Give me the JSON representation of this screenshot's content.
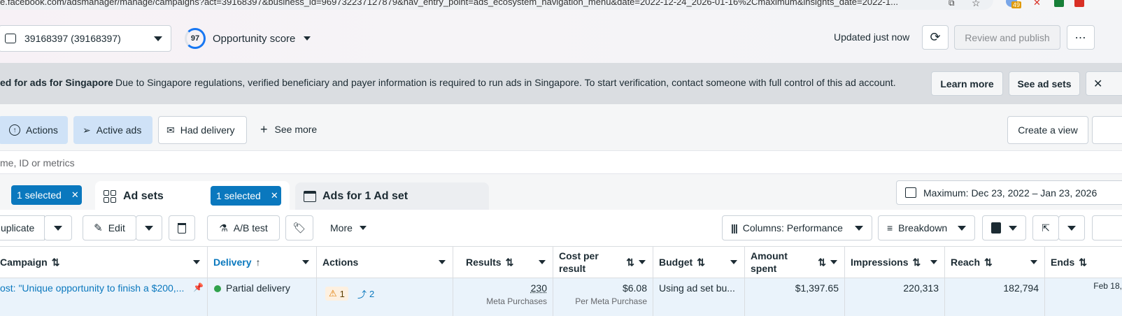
{
  "browser": {
    "url": "e.facebook.com/adsmanager/manage/campaigns?act=39168397&business_id=969732237127879&nav_entry_point=ads_ecosystem_navigation_menu&date=2022-12-24_2026-01-16%2Cmaximum&insights_date=2022-1...",
    "ext_badge": "49"
  },
  "topbar": {
    "account": "39168397 (39168397)",
    "score": "97",
    "opportunity": "Opportunity score",
    "updated": "Updated just now",
    "review": "Review and publish"
  },
  "banner": {
    "title": "ed for ads for Singapore",
    "text": "Due to Singapore regulations, verified beneficiary and payer information is required to run ads in Singapore. To start verification, contact someone with full control of this ad account.",
    "learn": "Learn more",
    "see_ad_sets": "See ad sets"
  },
  "filters": {
    "actions": "Actions",
    "active_ads": "Active ads",
    "had_delivery": "Had delivery",
    "see_more": "See more",
    "create_view": "Create a view"
  },
  "search": {
    "placeholder": "me, ID or metrics"
  },
  "tabs": {
    "campaign_selected": "1 selected",
    "ad_sets": "Ad sets",
    "adsets_selected": "1 selected",
    "ads": "Ads for 1 Ad set",
    "date": "Maximum: Dec 23, 2022 – Jan 23, 2026"
  },
  "toolbar": {
    "duplicate": "uplicate",
    "edit": "Edit",
    "ab_test": "A/B test",
    "more": "More",
    "columns": "Columns: Performance",
    "breakdown": "Breakdown"
  },
  "table": {
    "headers": {
      "campaign": "Campaign",
      "delivery": "Delivery",
      "actions": "Actions",
      "results": "Results",
      "cost_per_result_1": "Cost per",
      "cost_per_result_2": "result",
      "budget": "Budget",
      "amount_spent_1": "Amount",
      "amount_spent_2": "spent",
      "impressions": "Impressions",
      "reach": "Reach",
      "ends": "Ends"
    },
    "row": {
      "campaign": "ost: \"Unique opportunity to finish a $200,...",
      "delivery": "Partial delivery",
      "warning_count": "1",
      "recs_count": "2",
      "results": "230",
      "results_sub": "Meta Purchases",
      "cost": "$6.08",
      "cost_sub": "Per Meta Purchase",
      "budget": "Using ad set bu...",
      "amount_spent": "$1,397.65",
      "impressions": "220,313",
      "reach": "182,794",
      "ends": "Feb 18,"
    }
  },
  "colors": {
    "accent": "#0a78be",
    "selected_chip": "#1877f2",
    "filter_active": "#cfe2f7",
    "banner_bg": "#dadde1",
    "delivery_dot": "#31a24c",
    "warning": "#e07b00"
  }
}
